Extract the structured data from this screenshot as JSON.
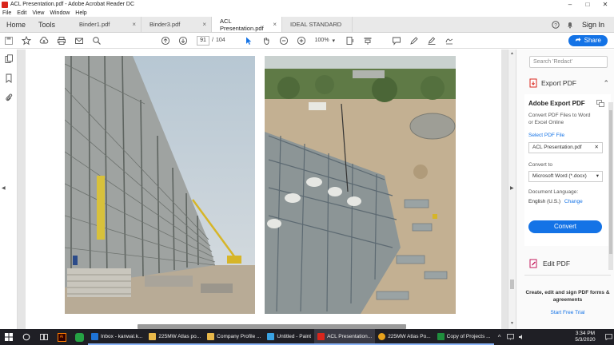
{
  "window": {
    "title": "ACL Presentation.pdf - Adobe Acrobat Reader DC",
    "minimize": "–",
    "maximize": "□",
    "close": "✕"
  },
  "menu": [
    "File",
    "Edit",
    "View",
    "Window",
    "Help"
  ],
  "nav": {
    "home": "Home",
    "tools": "Tools"
  },
  "tabs": [
    {
      "label": "Binder1.pdf",
      "close": "×"
    },
    {
      "label": "Binder3.pdf",
      "close": "×"
    },
    {
      "label": "ACL Presentation.pdf",
      "close": "×"
    },
    {
      "label": "IDEAL STANDARD",
      "close": ""
    }
  ],
  "header_right": {
    "help_icon": "?",
    "bell_icon": "🔔",
    "sign_in": "Sign In"
  },
  "toolbar": {
    "current_page": "91",
    "page_separator": "/",
    "total_pages": "104",
    "zoom": "100%",
    "zoom_caret": "▾",
    "share": "Share"
  },
  "right_panel": {
    "search_placeholder": "Search 'Redact'",
    "export_header": "Export PDF",
    "export_caret": "⌃",
    "box_title": "Adobe Export PDF",
    "box_desc": "Convert PDF Files to Word or Excel Online",
    "select_label": "Select PDF File",
    "file_name": "ACL Presentation.pdf",
    "file_remove": "✕",
    "convert_to_label": "Convert to",
    "convert_to_value": "Microsoft Word (*.docx)",
    "convert_caret": "▾",
    "doc_lang_label": "Document Language:",
    "doc_lang_value": "English (U.S.)",
    "change": "Change",
    "convert_button": "Convert",
    "edit_pdf": "Edit PDF",
    "promo": "Create, edit and sign PDF forms & agreements",
    "trial": "Start Free Trial"
  },
  "taskbar": {
    "buttons": [
      {
        "label": "Inbox - kanwal.k...",
        "color": "#1e73d6"
      },
      {
        "label": "225MW Atlas po...",
        "color": "#e8b84a"
      },
      {
        "label": "Company Profile ...",
        "color": "#e8b84a"
      },
      {
        "label": "Untitled - Paint",
        "color": "#3aa3e3"
      },
      {
        "label": "ACL Presentation...",
        "color": "#d9261c"
      },
      {
        "label": "225MW Atlas Po...",
        "color": "#e7a21c"
      },
      {
        "label": "Copy of Projects ...",
        "color": "#1f8e3d"
      }
    ],
    "time": "3:34 PM",
    "date": "5/3/2020"
  },
  "colors": {
    "accent": "#1473e6",
    "taskbar": "#1f1f25"
  }
}
